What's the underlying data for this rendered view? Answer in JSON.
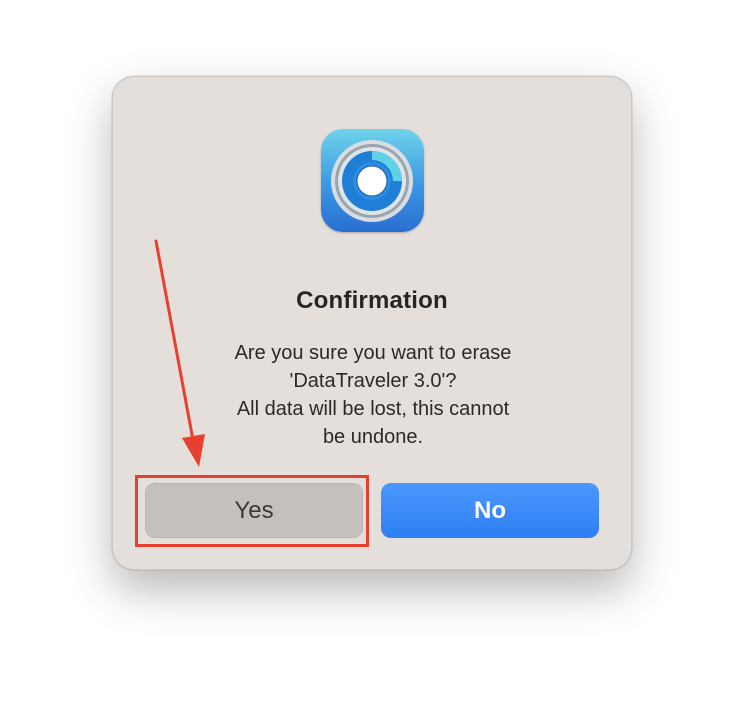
{
  "dialog": {
    "icon": "disk-utility-app-icon",
    "title": "Confirmation",
    "message_lines": [
      "Are you sure you want to erase",
      "'DataTraveler 3.0'?",
      "All data will be lost, this cannot",
      "be undone."
    ],
    "yes_label": "Yes",
    "no_label": "No"
  },
  "annotation": {
    "color": "#e8402f",
    "target": "yes-button"
  },
  "colors": {
    "dialog_bg": "#e4dfdb",
    "yes_button_bg": "#c6c0bc",
    "no_button_bg": "#2f7ff2"
  }
}
